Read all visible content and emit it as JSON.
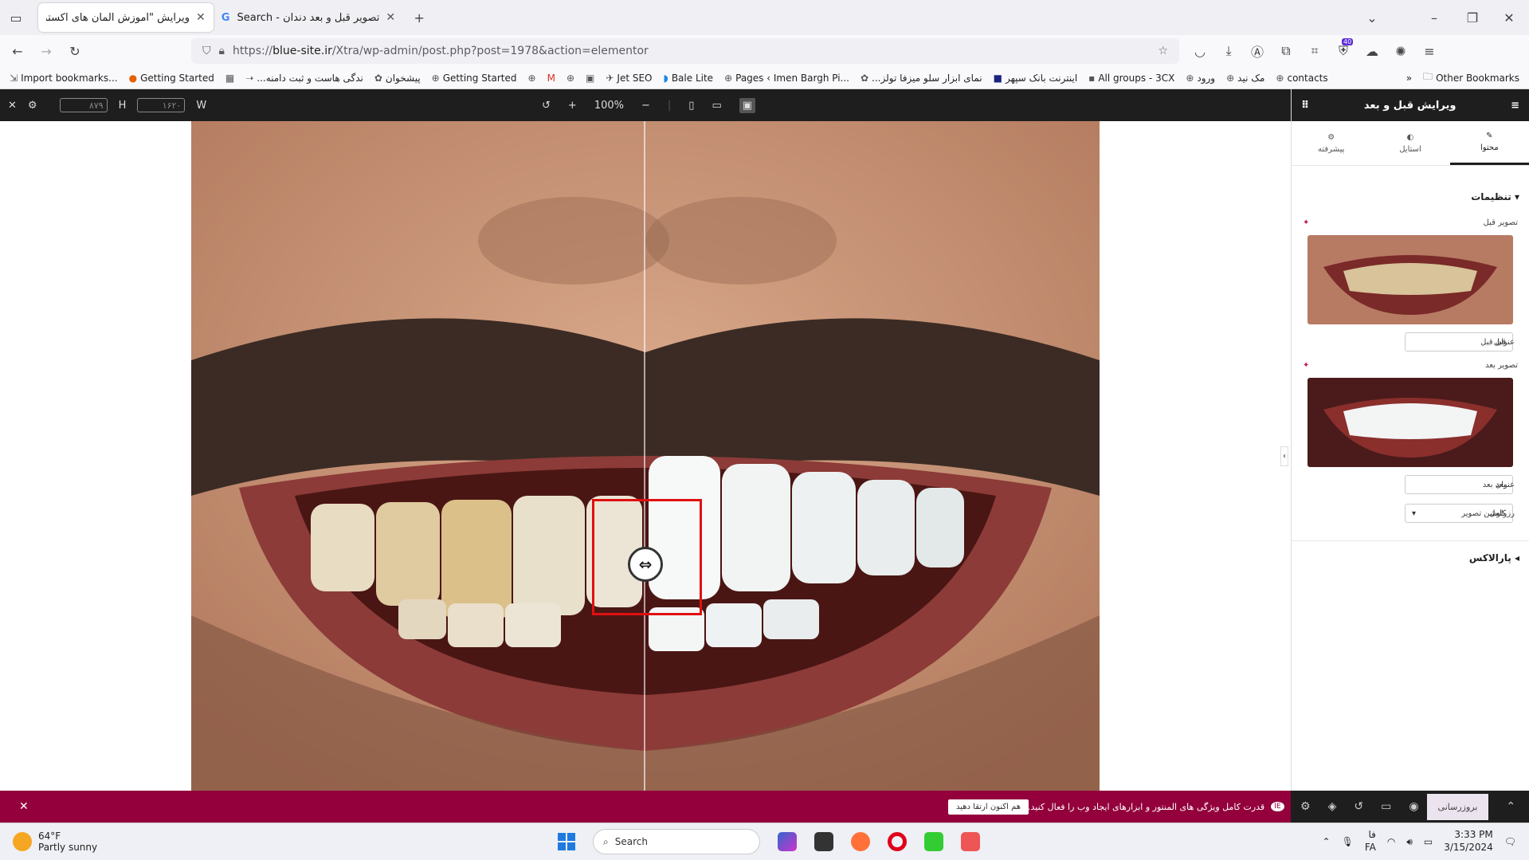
{
  "browser": {
    "tabs": [
      {
        "title": "ویرایش \"آموزش المان های اکسترا – ب",
        "active": true
      },
      {
        "title": "تصویر قبل و بعد دندان - Search",
        "active": false
      }
    ],
    "url_prefix": "https://",
    "url_domain": "blue-site.ir",
    "url_path": "/Xtra/wp-admin/post.php?post=1978&action=elementor",
    "bookmarks": [
      "Import bookmarks...",
      "Getting Started",
      "...ندگی هاست و ثبت دامنه",
      "پیشخوان",
      "Getting Started",
      "Jet SEO",
      "Bale Lite",
      "Pages ‹ Imen Bargh Pi...",
      "...نمای ابزار سلو میزفا تولز",
      "اینترنت بانک سپهر",
      "All groups - 3CX",
      "ورود",
      "مک نید",
      "contacts"
    ],
    "other_bookmarks": "Other Bookmarks",
    "badge": "40"
  },
  "editor": {
    "height_val": "۸۷۹",
    "height_label": "H",
    "width_val": "۱۶۲۰",
    "width_label": "W",
    "zoom": "100%"
  },
  "panel": {
    "title": "ویرایش قبل و بعد",
    "tabs": [
      {
        "label": "محتوا",
        "icon": "pencil-icon",
        "active": true
      },
      {
        "label": "استایل",
        "icon": "contrast-icon",
        "active": false
      },
      {
        "label": "پیشرفته",
        "icon": "gear-icon",
        "active": false
      }
    ],
    "section": "تنظیمات",
    "before_image_label": "تصویر قبل",
    "before_title_label": "عنوان قبل",
    "before_title_value": "قبل",
    "after_image_label": "تصویر بعد",
    "after_title_label": "عنوان بعد",
    "after_title_value": "بعد",
    "resolution_label": "رزولوشن تصویر",
    "resolution_value": "کامل",
    "parallax": "پارالاکس"
  },
  "notice": {
    "text": "قدرت کامل ویژگی های المنتور و ابزارهای ایجاد وب را فعال کنید.",
    "button": "هم اکنون ارتقا دهید"
  },
  "footer": {
    "update": "بروزرسانی"
  },
  "taskbar": {
    "temp": "64°F",
    "weather": "Partly sunny",
    "search": "Search",
    "lang1": "فا",
    "lang2": "FA",
    "time": "3:33 PM",
    "date": "3/15/2024"
  }
}
